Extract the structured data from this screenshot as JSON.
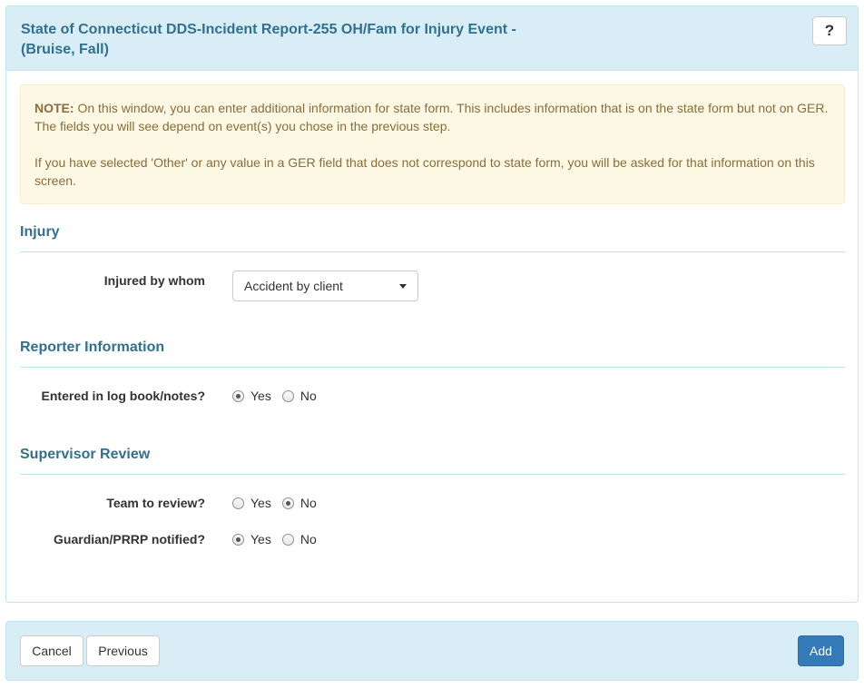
{
  "header": {
    "title_line1": "State of Connecticut DDS-Incident Report-255 OH/Fam for Injury Event -",
    "title_line2": "(Bruise, Fall)",
    "help_label": "?"
  },
  "note": {
    "bold": "NOTE:",
    "text1": " On this window, you can enter additional information for state form. This includes information that is on the state form but not on GER. The fields you will see depend on event(s) you chose in the previous step.",
    "text2": "If you have selected 'Other' or any value in a GER field that does not correspond to state form, you will be asked for that information on this screen."
  },
  "injury": {
    "section_title": "Injury",
    "injured_by_label": "Injured by whom",
    "injured_by_value": "Accident by client"
  },
  "reporter": {
    "section_title": "Reporter Information",
    "logbook_label": "Entered in log book/notes?",
    "logbook_selected": "Yes"
  },
  "supervisor": {
    "section_title": "Supervisor Review",
    "team_label": "Team to review?",
    "team_selected": "No",
    "guardian_label": "Guardian/PRRP notified?",
    "guardian_selected": "Yes"
  },
  "radio_labels": {
    "yes": "Yes",
    "no": "No"
  },
  "footer": {
    "cancel_label": "Cancel",
    "previous_label": "Previous",
    "add_label": "Add"
  },
  "colors": {
    "header_bg": "#d9edf7",
    "title_color": "#31708f",
    "note_bg": "#fcf8e3",
    "note_text": "#8a6d3b",
    "primary": "#337ab7"
  }
}
